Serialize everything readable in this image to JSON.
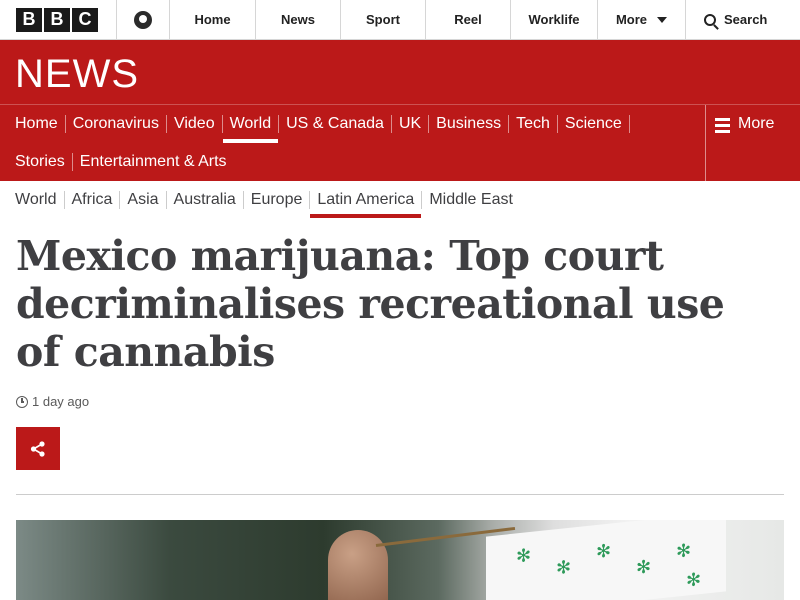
{
  "topbar": {
    "logo_letters": [
      "B",
      "B",
      "C"
    ],
    "nav": [
      "Home",
      "News",
      "Sport",
      "Reel",
      "Worklife"
    ],
    "more_label": "More",
    "search_label": "Search"
  },
  "newsband": {
    "logo_text": "NEWS"
  },
  "rednav": {
    "row1": [
      "Home",
      "Coronavirus",
      "Video",
      "World",
      "US & Canada",
      "UK",
      "Business",
      "Tech",
      "Science"
    ],
    "row2": [
      "Stories",
      "Entertainment & Arts"
    ],
    "active": "World",
    "more_label": "More"
  },
  "subnav": {
    "items": [
      "World",
      "Africa",
      "Asia",
      "Australia",
      "Europe",
      "Latin America",
      "Middle East"
    ],
    "active": "Latin America"
  },
  "article": {
    "headline": "Mexico marijuana: Top court decriminalises recreational use of cannabis",
    "timestamp": "1 day ago"
  },
  "colors": {
    "brand_red": "#bb1919",
    "text_dark": "#3f3f42"
  },
  "icons": {
    "account": "account-icon",
    "search": "search-icon",
    "menu": "hamburger-icon",
    "share": "share-icon",
    "time": "clock-icon"
  }
}
